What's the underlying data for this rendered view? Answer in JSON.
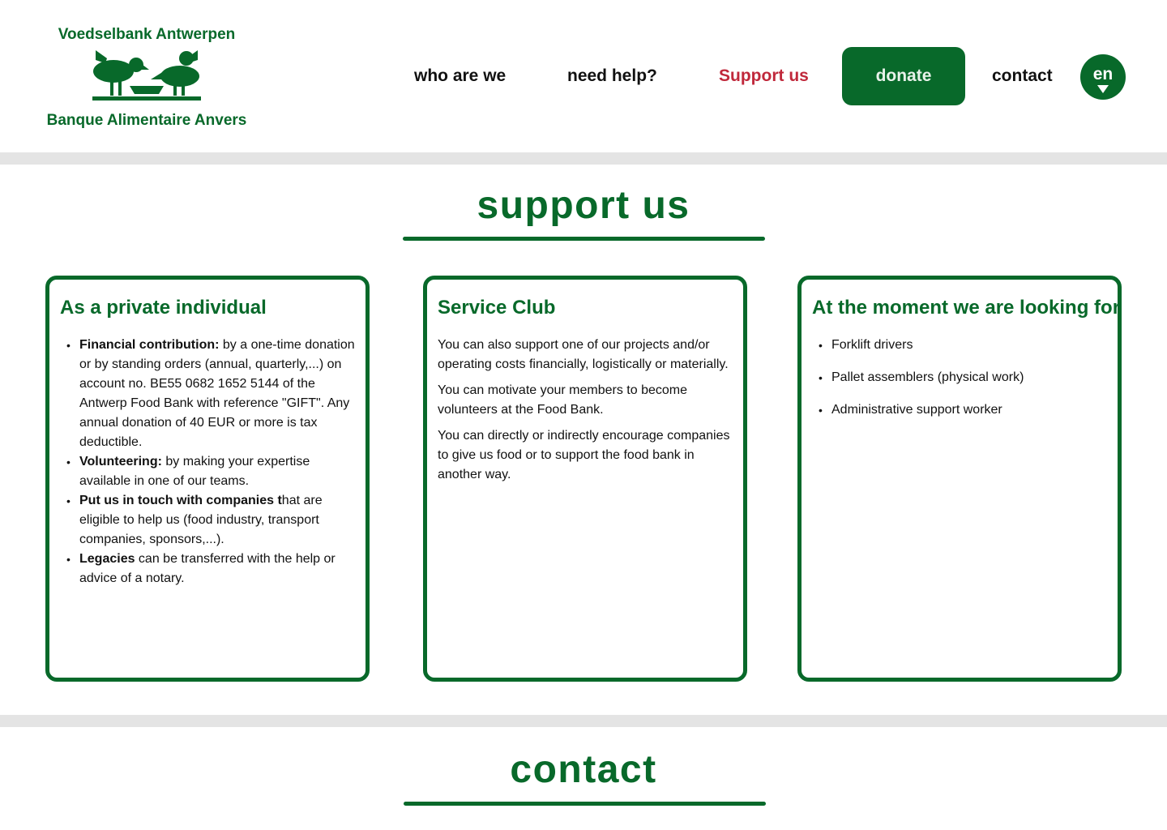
{
  "header": {
    "logo_top": "Voedselbank Antwerpen",
    "logo_bottom": "Banque Alimentaire Anvers",
    "logo_icon": "birds-feeding-icon",
    "nav": {
      "who": "who are we",
      "help": "need help?",
      "support": "Support us",
      "donate": "donate",
      "contact": "contact"
    },
    "language": "en"
  },
  "colors": {
    "brand_green": "#08692a",
    "active_red": "#c0283b",
    "divider_grey": "#e4e4e4"
  },
  "support_section": {
    "title": "support us",
    "cards": [
      {
        "title": "As a private individual",
        "items": [
          {
            "bold": "Financial contribution:",
            "text": " by a one-time donation or by standing orders (annual, quarterly,...) on account no. BE55 0682 1652 5144 of the Antwerp Food Bank with reference \"GIFT\". Any annual donation of 40 EUR or more is tax deductible."
          },
          {
            "bold": "Volunteering:",
            "text": " by making your expertise available in one of our teams."
          },
          {
            "bold": "Put us in touch with companies t",
            "text": "hat are eligible to help us (food industry, transport companies, sponsors,...)."
          },
          {
            "bold": "Legacies",
            "text": " can be transferred with the help or advice of a notary."
          }
        ]
      },
      {
        "title": "Service Club",
        "paragraphs": [
          "You can also support one of our projects and/or operating costs financially, logistically or materially.",
          "You can motivate your members to become volunteers at the Food Bank.",
          "You can directly or indirectly encourage companies to give us food or to support the food bank in another way."
        ]
      },
      {
        "title": "At the moment we are looking for",
        "items": [
          "Forklift drivers",
          "Pallet assemblers (physical work)",
          "Administrative support worker"
        ]
      }
    ]
  },
  "contact_section": {
    "title": "contact"
  }
}
